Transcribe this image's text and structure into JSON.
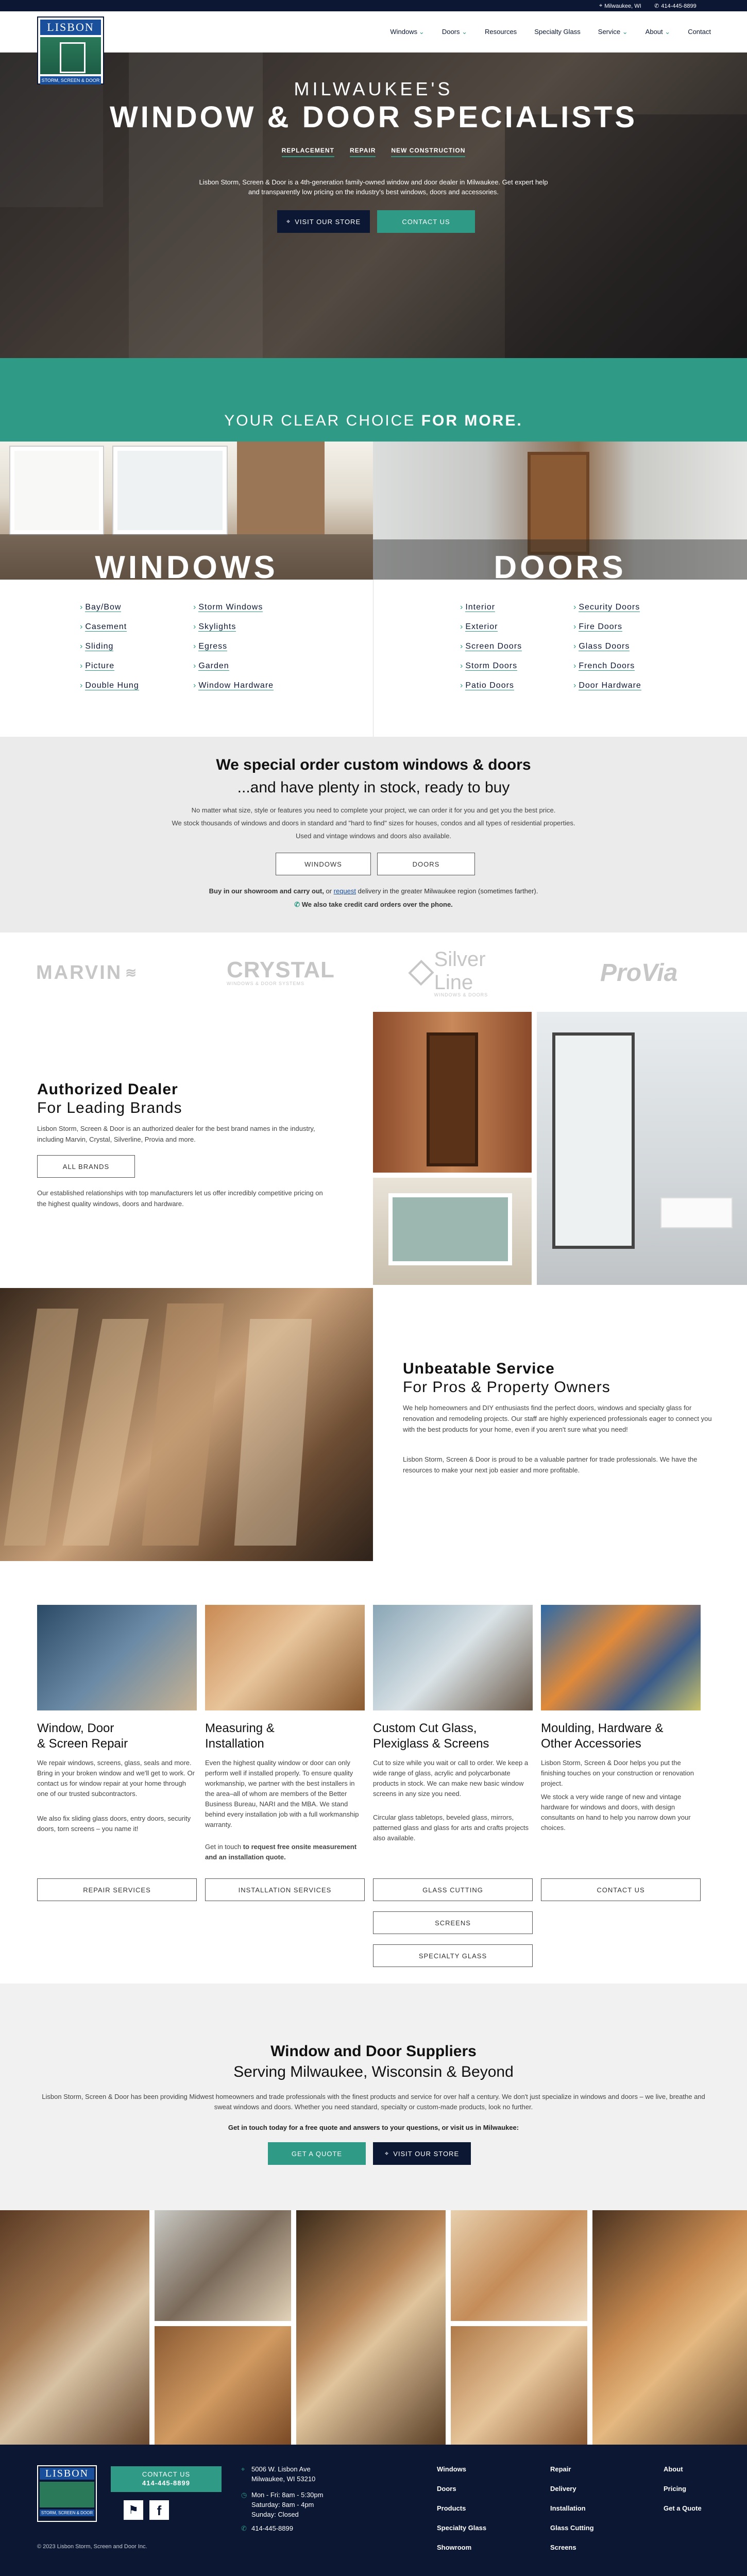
{
  "topbar": {
    "location": "Milwaukee, WI",
    "phone": "414-445-8899"
  },
  "logo": {
    "title": "LISBON",
    "sub": "STORM, SCREEN & DOOR"
  },
  "nav": [
    {
      "label": "Windows",
      "caret": "⌄"
    },
    {
      "label": "Doors",
      "caret": "⌄"
    },
    {
      "label": "Resources",
      "caret": ""
    },
    {
      "label": "Specialty Glass",
      "caret": ""
    },
    {
      "label": "Service",
      "caret": "⌄"
    },
    {
      "label": "About",
      "caret": "⌄"
    },
    {
      "label": "Contact",
      "caret": ""
    }
  ],
  "hero": {
    "eyebrow": "MILWAUKEE'S",
    "title": "WINDOW & DOOR SPECIALISTS",
    "tags": [
      "REPLACEMENT",
      "REPAIR",
      "NEW CONSTRUCTION"
    ],
    "text": "Lisbon Storm, Screen & Door is a 4th-generation family-owned window and door dealer in Milwaukee. Get expert help and transparently low pricing on the industry's best windows, doors and accessories.",
    "btn_store": "VISIT OUR STORE",
    "btn_contact": "CONTACT US"
  },
  "band": {
    "text_a": "YOUR CLEAR CHOICE ",
    "text_b": "FOR MORE."
  },
  "windows": {
    "title": "WINDOWS",
    "col1": [
      "Bay/Bow",
      "Casement",
      "Sliding",
      "Picture",
      "Double Hung"
    ],
    "col2": [
      "Storm Windows",
      "Skylights",
      "Egress",
      "Garden",
      "Window Hardware"
    ]
  },
  "doors": {
    "title": "DOORS",
    "col1": [
      "Interior",
      "Exterior",
      "Screen Doors",
      "Storm Doors",
      "Patio Doors"
    ],
    "col2": [
      "Security Doors",
      "Fire Doors",
      "Glass Doors",
      "French Doors",
      "Door Hardware"
    ]
  },
  "special": {
    "h1": "We special order custom windows & doors",
    "h2": "...and have plenty in stock, ready to buy",
    "p1": "No matter what size, style or features you need to complete your project, we can order it for you and get you the best price.",
    "p2": "We stock thousands of windows and doors in standard and \"hard to find\" sizes for houses, condos and all types of residential properties.",
    "p3": "Used and vintage windows and doors also available.",
    "btn_windows": "WINDOWS",
    "btn_doors": "DOORS",
    "note_a": "Buy in our showroom and carry out,",
    "note_b": " or ",
    "note_c": "request",
    "note_d": " delivery in the greater Milwaukee region (sometimes farther).",
    "credit": "We also take credit card orders over the phone."
  },
  "brands": [
    "MARVIN",
    "CRYSTAL",
    "Silver Line",
    "ProVia"
  ],
  "brand_subs": {
    "crystal": "WINDOWS & DOOR SYSTEMS",
    "silverline": "WINDOWS & DOORS"
  },
  "authorized": {
    "h_a": "Authorized Dealer",
    "h_b": "For Leading Brands",
    "p1": "Lisbon Storm, Screen & Door is an authorized dealer for the best brand names in the industry, including Marvin, Crystal, Silverline, Provia and more.",
    "btn": "ALL BRANDS",
    "p2": "Our established relationships with top manufacturers let us offer incredibly competitive pricing on the highest quality windows, doors and hardware."
  },
  "service": {
    "h_a": "Unbeatable Service",
    "h_b": "For Pros & Property Owners",
    "p1": "We help homeowners and DIY enthusiasts find the perfect doors, windows and specialty glass for renovation and remodeling projects. Our staff are highly experienced professionals eager to connect you with the best products for your home, even if you aren't sure what you need!",
    "p2": "Lisbon Storm, Screen & Door is proud to be a valuable partner for trade professionals. We have the resources to make your next job easier and more profitable."
  },
  "services": [
    {
      "title_a": "Window, Door",
      "title_b": "& Screen Repair",
      "p1": "We repair windows, screens, glass, seals and more. Bring in your broken window and we'll get to work. Or contact us for window repair at your home through one of our trusted subcontractors.",
      "p2": "We also fix sliding glass doors, entry doors, security doors, torn screens – you name it!",
      "btn": "REPAIR SERVICES"
    },
    {
      "title_a": "Measuring &",
      "title_b": "Installation",
      "p1": "Even the highest quality window or door can only perform well if installed properly. To ensure quality workmanship, we partner with the best installers in the area–all of whom are members of the Better Business Bureau, NARI and the MBA. We stand behind every installation job with a full workmanship warranty.",
      "p2a": "Get in touch ",
      "p2b": "to request free onsite measurement and an installation quote.",
      "btn": "INSTALLATION SERVICES"
    },
    {
      "title_a": "Custom Cut Glass,",
      "title_b": "Plexiglass & Screens",
      "p1": "Cut to size while you wait or call to order. We keep a wide range of glass, acrylic and polycarbonate products in stock. We can make new basic window screens in any size you need.",
      "p2": "Circular glass tabletops, beveled glass, mirrors, patterned glass and glass for arts and crafts projects also available.",
      "btn": "GLASS CUTTING",
      "btn2": "SCREENS",
      "btn3": "SPECIALTY GLASS"
    },
    {
      "title_a": "Moulding, Hardware &",
      "title_b": "Other Accessories",
      "p1": "Lisbon Storm, Screen & Door helps you put the finishing touches on your construction or renovation project.",
      "p2": "We stock a very wide range of new and vintage hardware for windows and doors, with design consultants on hand to help you narrow down your choices.",
      "btn": "CONTACT US"
    }
  ],
  "suppliers": {
    "h1": "Window and Door Suppliers",
    "h2": "Serving Milwaukee, Wisconsin & Beyond",
    "p": "Lisbon Storm, Screen & Door has been providing Midwest homeowners and trade professionals with the finest products and service for over half a century. We don't just specialize in windows and doors – we live, breathe and sweat windows and doors. Whether you need standard, specialty or custom-made products, look no further.",
    "cta": "Get in touch today for a free quote and answers to your questions, or visit us in Milwaukee:",
    "btn_quote": "GET A QUOTE",
    "btn_store": "VISIT OUR STORE"
  },
  "footer": {
    "contact_btn": "CONTACT US",
    "phone_btn": "414-445-8899",
    "address1": "5006 W. Lisbon Ave",
    "address2": "Milwaukee, WI 53210",
    "hours1": "Mon - Fri: 8am - 5:30pm",
    "hours2": "Saturday: 8am - 4pm",
    "hours3": "Sunday: Closed",
    "phone": "414-445-8899",
    "col1": [
      "Windows",
      "Doors",
      "Products",
      "Specialty Glass",
      "Showroom"
    ],
    "col2": [
      "Repair",
      "Delivery",
      "Installation",
      "Glass Cutting",
      "Screens"
    ],
    "col3": [
      "About",
      "Pricing",
      "Get a Quote"
    ],
    "copyright": "© 2023 Lisbon Storm, Screen and Door Inc."
  },
  "colors": {
    "navy": "#0b1733",
    "teal": "#2f9a86",
    "blue": "#1a4f9c"
  }
}
